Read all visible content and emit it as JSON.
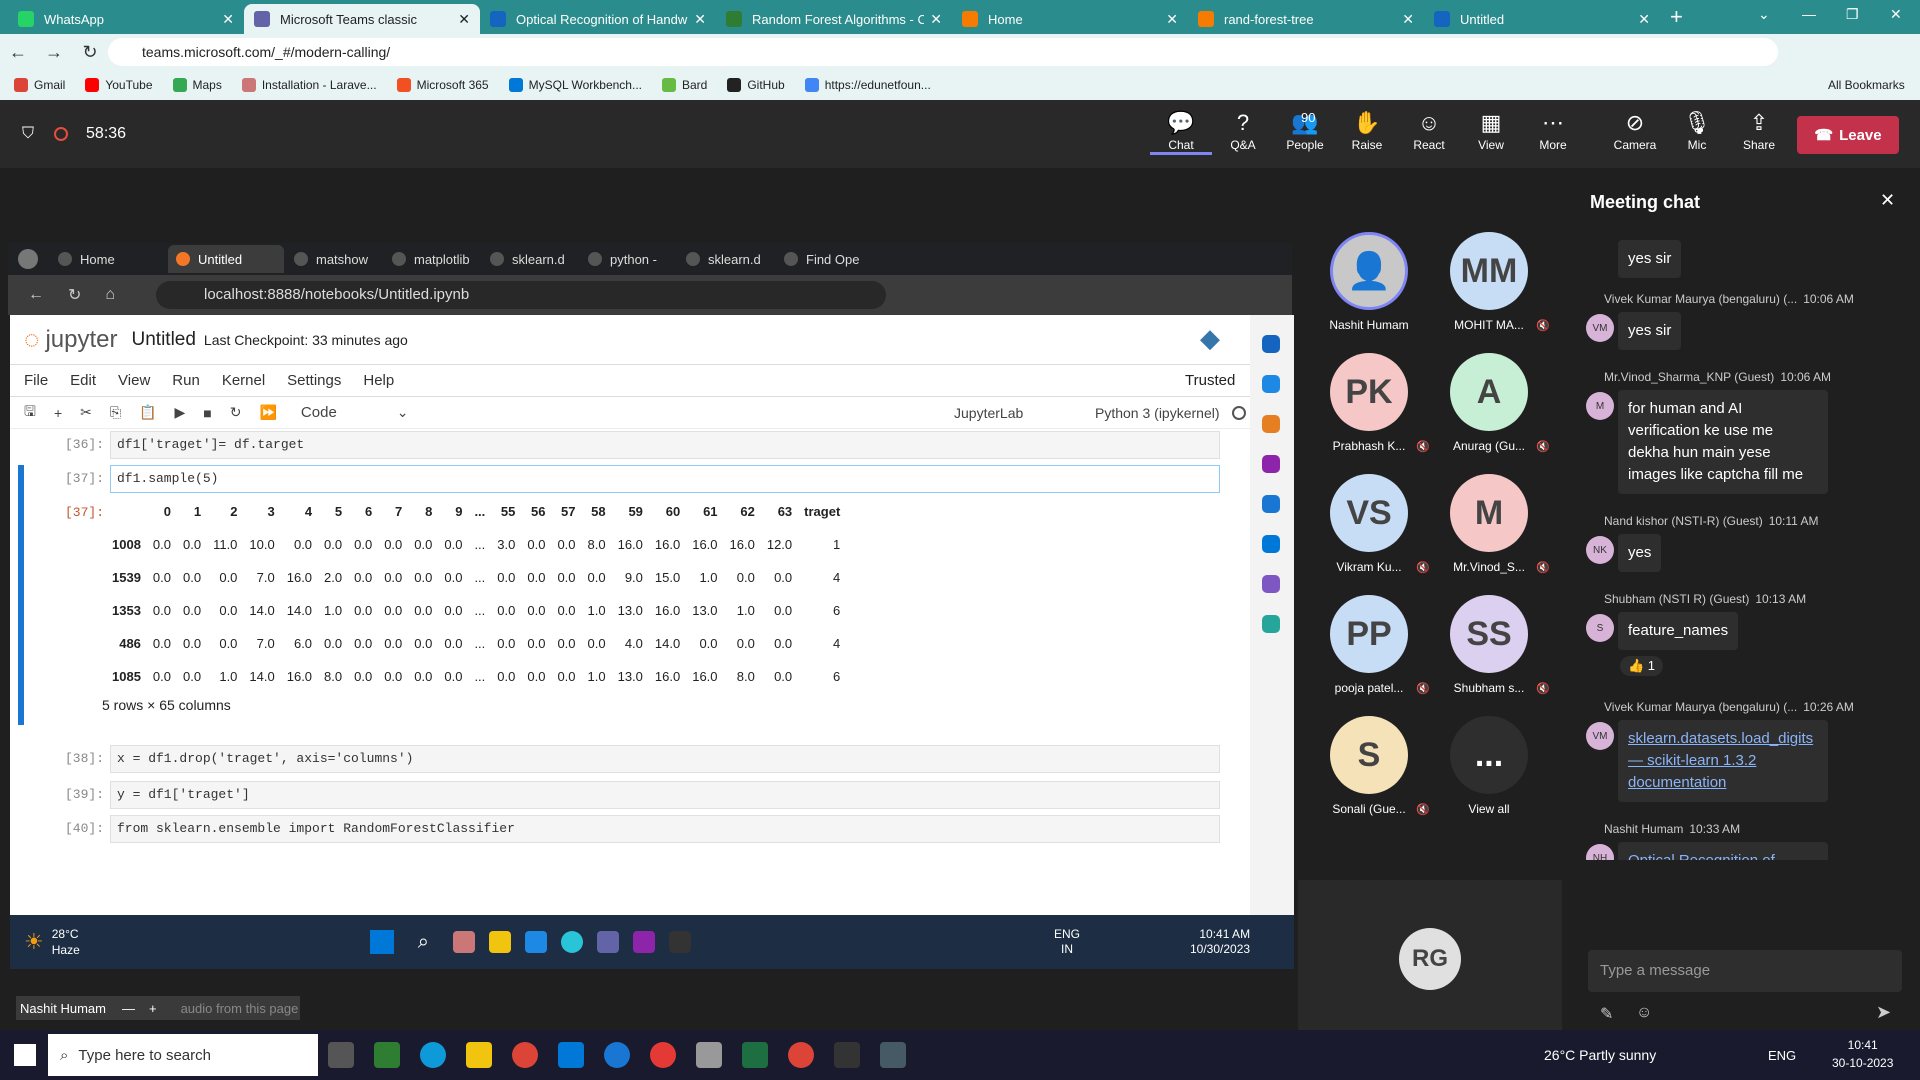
{
  "browser": {
    "tabs": [
      {
        "title": "WhatsApp",
        "color": "#25d366"
      },
      {
        "title": "Microsoft Teams classic",
        "color": "#6264a7",
        "active": true
      },
      {
        "title": "Optical Recognition of Handwri",
        "color": "#1565c0"
      },
      {
        "title": "Random Forest Algorithms - Co",
        "color": "#2e7d32"
      },
      {
        "title": "Home",
        "color": "#f57c00"
      },
      {
        "title": "rand-forest-tree",
        "color": "#f57c00"
      },
      {
        "title": "Untitled",
        "color": "#1565c0"
      }
    ],
    "url": "teams.microsoft.com/_#/modern-calling/",
    "bookmarks": [
      "Gmail",
      "YouTube",
      "Maps",
      "Installation - Larave...",
      "Microsoft 365",
      "MySQL Workbench...",
      "Bard",
      "GitHub",
      "https://edunetfoun..."
    ],
    "all_bookmarks": "All Bookmarks"
  },
  "teams": {
    "timer": "58:36",
    "toolbar": [
      {
        "icon": "chat-icon",
        "label": "Chat"
      },
      {
        "icon": "qa-icon",
        "label": "Q&A"
      },
      {
        "icon": "people-icon",
        "label": "People",
        "count": "90"
      },
      {
        "icon": "raise-hand-icon",
        "label": "Raise"
      },
      {
        "icon": "react-icon",
        "label": "React"
      },
      {
        "icon": "view-icon",
        "label": "View"
      },
      {
        "icon": "more-icon",
        "label": "More"
      },
      {
        "icon": "camera-icon",
        "label": "Camera"
      },
      {
        "icon": "mic-icon",
        "label": "Mic"
      },
      {
        "icon": "share-icon",
        "label": "Share"
      }
    ],
    "leave": "Leave",
    "presenter": "Nashit Humam"
  },
  "shared": {
    "tabs": [
      "Home",
      "Untitled",
      "matshow",
      "matplotlib",
      "sklearn.d",
      "python -",
      "sklearn.d",
      "Find Ope"
    ],
    "url": "localhost:8888/notebooks/Untitled.ipynb",
    "jupyter": {
      "logo": "jupyter",
      "title": "Untitled",
      "checkpoint": "Last Checkpoint: 33 minutes ago",
      "trusted": "Trusted",
      "menu": [
        "File",
        "Edit",
        "View",
        "Run",
        "Kernel",
        "Settings",
        "Help"
      ],
      "celltype": "Code",
      "jupyterlab": "JupyterLab",
      "kernel": "Python 3 (ipykernel)",
      "cells": [
        {
          "prompt": "[36]:",
          "code": "df1['traget']= df.target"
        },
        {
          "prompt": "[37]:",
          "code": "df1.sample(5)"
        },
        {
          "prompt": "[38]:",
          "code": "x = df1.drop('traget', axis='columns')"
        },
        {
          "prompt": "[39]:",
          "code": "y = df1['traget']"
        },
        {
          "prompt": "[40]:",
          "code": "from sklearn.ensemble import RandomForestClassifier"
        }
      ],
      "out_prompt": "[37]:",
      "table": {
        "columns": [
          "0",
          "1",
          "2",
          "3",
          "4",
          "5",
          "6",
          "7",
          "8",
          "9",
          "...",
          "55",
          "56",
          "57",
          "58",
          "59",
          "60",
          "61",
          "62",
          "63",
          "traget"
        ],
        "rows": [
          {
            "index": "1008",
            "values": [
              "0.0",
              "0.0",
              "11.0",
              "10.0",
              "0.0",
              "0.0",
              "0.0",
              "0.0",
              "0.0",
              "0.0",
              "...",
              "3.0",
              "0.0",
              "0.0",
              "8.0",
              "16.0",
              "16.0",
              "16.0",
              "16.0",
              "12.0",
              "1"
            ]
          },
          {
            "index": "1539",
            "values": [
              "0.0",
              "0.0",
              "0.0",
              "7.0",
              "16.0",
              "2.0",
              "0.0",
              "0.0",
              "0.0",
              "0.0",
              "...",
              "0.0",
              "0.0",
              "0.0",
              "0.0",
              "9.0",
              "15.0",
              "1.0",
              "0.0",
              "0.0",
              "4"
            ]
          },
          {
            "index": "1353",
            "values": [
              "0.0",
              "0.0",
              "0.0",
              "14.0",
              "14.0",
              "1.0",
              "0.0",
              "0.0",
              "0.0",
              "0.0",
              "...",
              "0.0",
              "0.0",
              "0.0",
              "1.0",
              "13.0",
              "16.0",
              "13.0",
              "1.0",
              "0.0",
              "6"
            ]
          },
          {
            "index": "486",
            "values": [
              "0.0",
              "0.0",
              "0.0",
              "7.0",
              "6.0",
              "0.0",
              "0.0",
              "0.0",
              "0.0",
              "0.0",
              "...",
              "0.0",
              "0.0",
              "0.0",
              "0.0",
              "4.0",
              "14.0",
              "0.0",
              "0.0",
              "0.0",
              "4"
            ]
          },
          {
            "index": "1085",
            "values": [
              "0.0",
              "0.0",
              "1.0",
              "14.0",
              "16.0",
              "8.0",
              "0.0",
              "0.0",
              "0.0",
              "0.0",
              "...",
              "0.0",
              "0.0",
              "0.0",
              "1.0",
              "13.0",
              "16.0",
              "16.0",
              "8.0",
              "0.0",
              "6"
            ]
          }
        ],
        "shape": "5 rows × 65 columns"
      }
    },
    "taskbar": {
      "weather": "28°C",
      "weather_desc": "Haze",
      "lang": "ENG",
      "lang2": "IN",
      "time": "10:41 AM",
      "date": "10/30/2023"
    }
  },
  "participants": [
    {
      "initials": "",
      "name": "Nashit Humam",
      "color": "#c8c8c8"
    },
    {
      "initials": "MM",
      "name": "MOHIT MA...",
      "color": "#c7dcf5"
    },
    {
      "initials": "PK",
      "name": "Prabhash K...",
      "color": "#f5c7c7"
    },
    {
      "initials": "A",
      "name": "Anurag (Gu...",
      "color": "#c7efd5"
    },
    {
      "initials": "VS",
      "name": "Vikram Ku...",
      "color": "#c7dcf5"
    },
    {
      "initials": "M",
      "name": "Mr.Vinod_S...",
      "color": "#f5c7c7"
    },
    {
      "initials": "PP",
      "name": "pooja patel...",
      "color": "#c7dcf5"
    },
    {
      "initials": "SS",
      "name": "Shubham s...",
      "color": "#dcd0f0"
    },
    {
      "initials": "S",
      "name": "Sonali (Gue...",
      "color": "#f5e2b8"
    },
    {
      "initials": "...",
      "name": "View all",
      "color": "#2e2e2e"
    }
  ],
  "rg_tile": "RG",
  "chat": {
    "title": "Meeting chat",
    "messages": [
      {
        "sender": "",
        "time": "",
        "text": "yes sir"
      },
      {
        "sender": "Vivek Kumar Maurya (bengaluru) (...",
        "time": "10:06 AM",
        "text": "yes sir",
        "av": "VM"
      },
      {
        "sender": "Mr.Vinod_Sharma_KNP (Guest)",
        "time": "10:06 AM",
        "text": "for human and AI verification ke use me dekha hun main yese images like captcha fill me",
        "av": "M"
      },
      {
        "sender": "Nand kishor (NSTI-R) (Guest)",
        "time": "10:11 AM",
        "text": "yes",
        "av": "NK"
      },
      {
        "sender": "Shubham (NSTI R) (Guest)",
        "time": "10:13 AM",
        "text": "feature_names",
        "reaction": "👍 1",
        "av": "S"
      },
      {
        "sender": "Vivek Kumar Maurya (bengaluru) (...",
        "time": "10:26 AM",
        "text": "sklearn.datasets.load_digits — scikit-learn 1.3.2 documentation",
        "link": true,
        "av": "VM"
      },
      {
        "sender": "Nashit Humam",
        "time": "10:33 AM",
        "text": "Optical Recognition of Handwritten Digits - UCI Machine Learning Repository",
        "link": true,
        "av": "NH"
      }
    ],
    "placeholder": "Type a message"
  },
  "sharing_bar": "Nashit Humam",
  "sharing_text": "audio from this page",
  "windows": {
    "search_placeholder": "Type here to search",
    "weather": "26°C  Partly sunny",
    "lang": "ENG",
    "time": "10:41",
    "date": "30-10-2023"
  }
}
